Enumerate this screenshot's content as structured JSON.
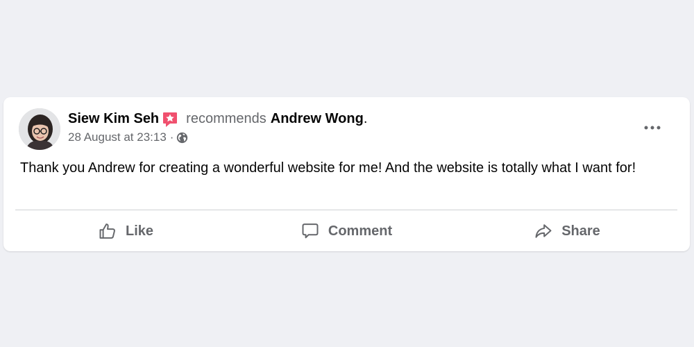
{
  "post": {
    "author": "Siew Kim Seh",
    "verb": "recommends",
    "target": "Andrew Wong",
    "period": ".",
    "timestamp": "28 August at 23:13",
    "separator": "·",
    "privacy_icon": "globe-icon",
    "badge_icon": "recommendation-star-icon",
    "more_icon": "more-options-icon",
    "body": "Thank you Andrew for creating a wonderful website for me! And the website is totally what I want for!"
  },
  "actions": {
    "like": {
      "label": "Like",
      "icon": "thumbs-up-icon"
    },
    "comment": {
      "label": "Comment",
      "icon": "comment-icon"
    },
    "share": {
      "label": "Share",
      "icon": "share-icon"
    }
  },
  "colors": {
    "background": "#eff0f4",
    "card": "#ffffff",
    "primary_text": "#050505",
    "secondary_text": "#65676b",
    "badge": "#f0506e",
    "divider": "#ced0d4"
  }
}
